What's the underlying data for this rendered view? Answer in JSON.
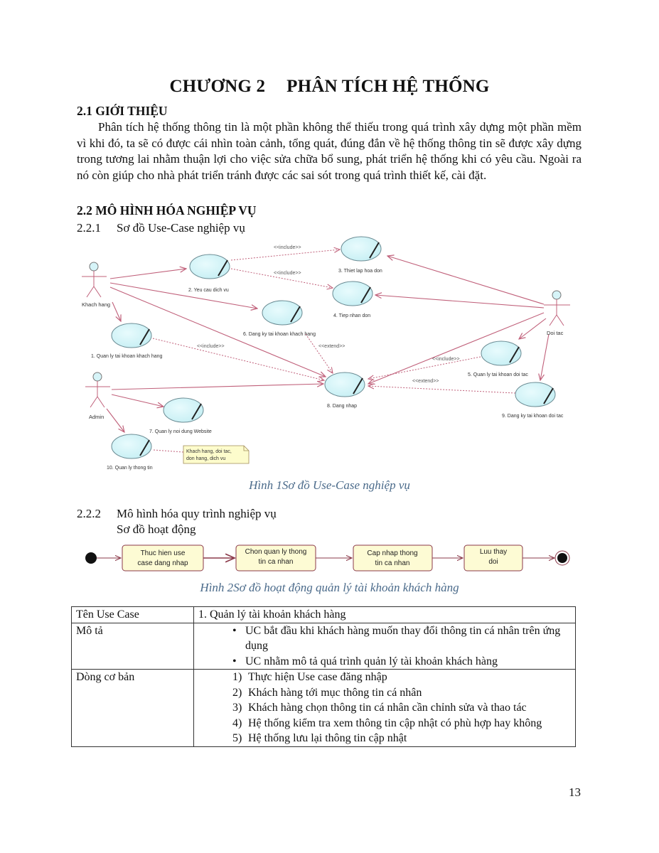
{
  "chapter": {
    "number": "CHƯƠNG 2",
    "title": "PHÂN TÍCH HỆ THỐNG"
  },
  "section_2_1": {
    "heading": "2.1 GIỚI THIỆU",
    "paragraph": "Phân tích hệ thống thông tin là một phần không thể thiếu trong quá trình xây dựng một phần mềm vì khi đó, ta sẽ có được cái nhìn toàn cảnh, tổng quát, đúng đắn về hệ thống thông tin sẽ được xây dựng trong tương lai nhằm thuận lợi cho việc sửa chữa bổ sung, phát triển hệ thống khi có yêu cầu. Ngoài ra nó còn giúp cho nhà phát triển tránh được các sai sót trong quá trình thiết kế, cài đặt."
  },
  "section_2_2": {
    "heading": "2.2 MÔ HÌNH HÓA NGHIỆP VỤ",
    "sub1": {
      "number": "2.2.1",
      "title": "Sơ đồ Use-Case nghiệp vụ"
    },
    "sub2": {
      "number": "2.2.2",
      "title": "Mô hình hóa quy trình nghiệp vụ",
      "subtitle": "Sơ đồ hoạt động"
    }
  },
  "usecase_diagram": {
    "caption": "Hình 1Sơ đồ Use-Case nghiệp vụ",
    "actors": [
      "Khach hang",
      "Admin",
      "Doi tac"
    ],
    "usecases": {
      "uc1": "1. Quan ly tai khoan khach hang",
      "uc2": "2. Yeu cau dich vu",
      "uc3": "3. Thiet lap hoa don",
      "uc4": "4. Tiep nhan don",
      "uc5": "5. Quan ly tai khoan doi tac",
      "uc6": "6. Dang ky tai khoan khach hang",
      "uc7": "7. Quan ly noi dung Website",
      "uc8": "8. Dang nhap",
      "uc9": "9. Dang ky tai khoan doi tac",
      "uc10": "10. Quan ly thong tin"
    },
    "stereotypes": {
      "include": "<<include>>",
      "extend": "<<extend>>"
    },
    "note": [
      "Khach hang, doi tac,",
      "don hang, dich vu"
    ],
    "colors": {
      "usecase_fill": "#d6f4f8",
      "line": "#c0607a",
      "note_fill": "#fdfccc"
    }
  },
  "activity_diagram": {
    "caption": "Hình 2Sơ đồ hoạt động quản lý tài khoản khách hàng",
    "activities": [
      [
        "Thuc hien use",
        "case dang nhap"
      ],
      [
        "Chon quan ly thong",
        "tin ca nhan"
      ],
      [
        "Cap nhap thong",
        "tin ca nhan"
      ],
      [
        "Luu thay",
        "doi"
      ]
    ],
    "colors": {
      "activity_fill": "#fdfbd4",
      "border": "#8b3a4a"
    }
  },
  "usecase_table": {
    "rows": [
      {
        "key": "Tên Use Case",
        "value": "1. Quản lý tài khoản khách hàng"
      },
      {
        "key": "Mô tả",
        "bullets": [
          "UC bắt đầu khi khách hàng muốn thay đổi thông tin cá nhân trên ứng dụng",
          "UC nhằm mô tả quá trình quản lý tài khoản khách hàng"
        ]
      },
      {
        "key": "Dòng cơ bản",
        "steps": [
          {
            "n": "1)",
            "text": "Thực hiện Use case đăng nhập"
          },
          {
            "n": "2)",
            "text": "Khách hàng tới mục thông tin cá nhân"
          },
          {
            "n": "3)",
            "text": "Khách hàng chọn thông tin cá nhân cần chỉnh sửa và thao tác"
          },
          {
            "n": "4)",
            "text": "Hệ thống kiểm tra xem thông tin cập nhật có phù hợp hay không"
          },
          {
            "n": "5)",
            "text": "Hệ thống lưu lại thông tin cập nhật"
          }
        ]
      }
    ]
  },
  "page_number": "13"
}
